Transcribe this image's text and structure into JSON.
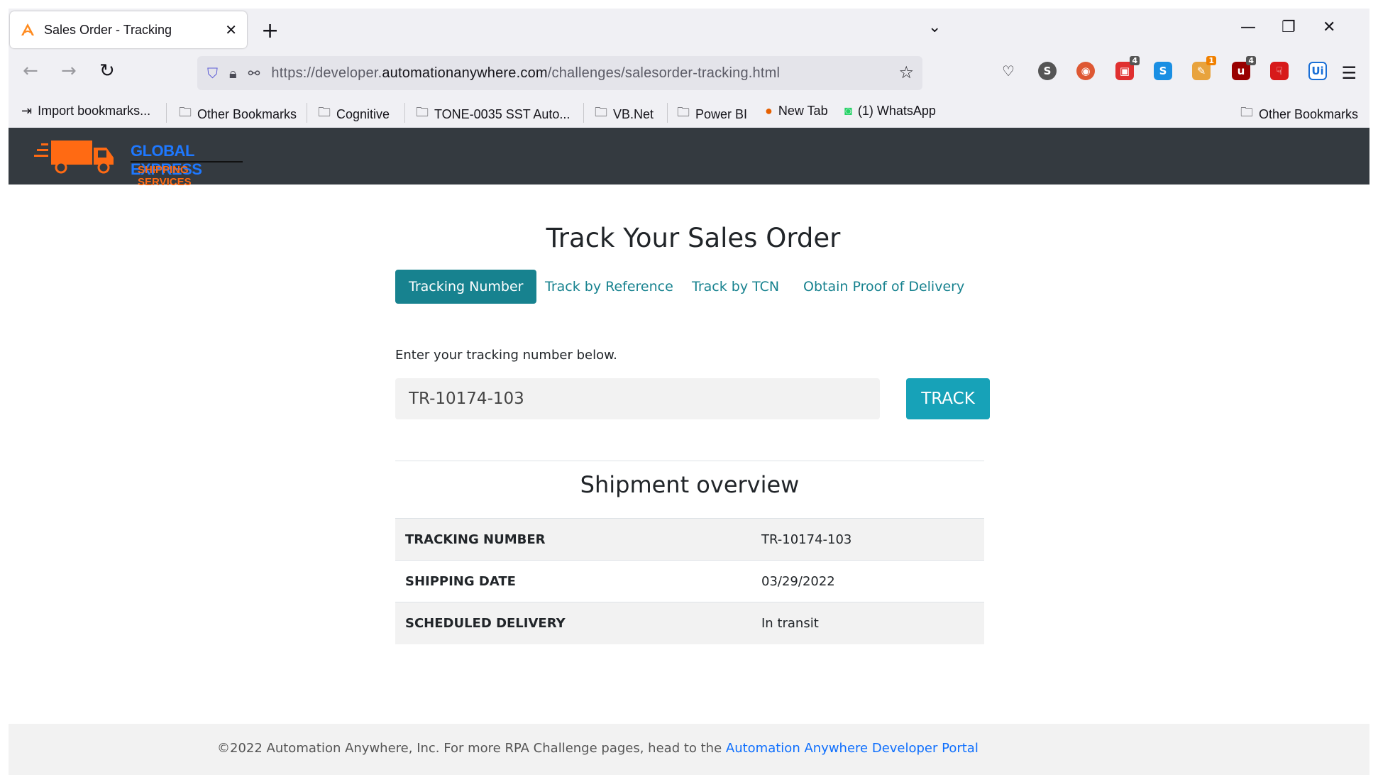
{
  "browser": {
    "tab_title": "Sales Order - Tracking",
    "tab_close": "✕",
    "new_tab": "+",
    "url_prefix": "https://developer.",
    "url_domain": "automationanywhere.com",
    "url_path": "/challenges/salesorder-tracking.html",
    "bookmarks": [
      "Import bookmarks...",
      "Other Bookmarks",
      "Cognitive",
      "TONE-0035 SST Auto...",
      "VB.Net",
      "Power BI",
      "New Tab",
      "(1) WhatsApp"
    ],
    "bookmarks_right": "Other Bookmarks",
    "extension_badges": [
      "4",
      "1",
      "4"
    ],
    "extensions": [
      "S",
      "S",
      "Ui"
    ]
  },
  "header": {
    "logo_line1": "GLOBAL EXPRESS",
    "logo_line2": "SHIPPING SERVICES"
  },
  "main": {
    "title": "Track Your Sales Order",
    "tabs": [
      "Tracking Number",
      "Track by Reference",
      "Track by TCN",
      "Obtain Proof of Delivery"
    ],
    "instruction": "Enter your tracking number below.",
    "tracking_value": "TR-10174-103",
    "track_button": "TRACK",
    "overview_title": "Shipment overview",
    "overview_rows": [
      {
        "label": "TRACKING NUMBER",
        "value": "TR-10174-103"
      },
      {
        "label": "SHIPPING DATE",
        "value": "03/29/2022"
      },
      {
        "label": "SCHEDULED DELIVERY",
        "value": "In transit"
      }
    ]
  },
  "footer": {
    "text": "©2022 Automation Anywhere, Inc. For more RPA Challenge pages, head to the ",
    "link": "Automation Anywhere Developer Portal"
  },
  "colors": {
    "header_bg": "#343a40",
    "accent_teal": "#17828f",
    "track_button": "#17a2b8",
    "link_blue": "#0d6efd",
    "logo_blue": "#1e78ff",
    "logo_orange": "#ff6a13"
  }
}
